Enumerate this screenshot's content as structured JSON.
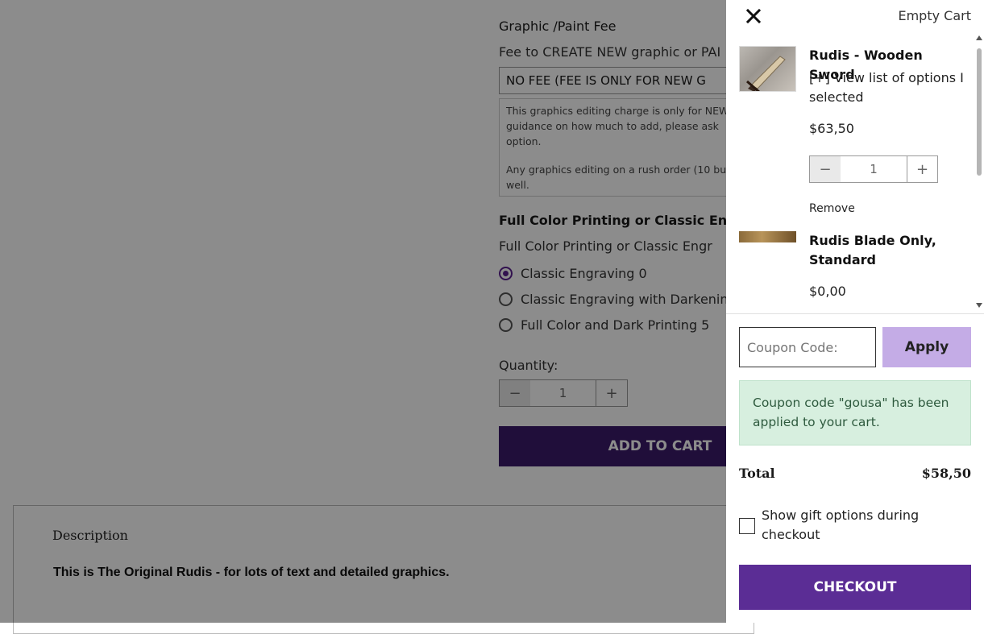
{
  "product": {
    "graphic_fee_title": "Graphic /Paint Fee",
    "graphic_fee_label": "Fee to CREATE NEW graphic or PAI",
    "graphic_fee_selected": "NO FEE (FEE IS ONLY FOR NEW G",
    "note_1_line_1": "This graphics editing charge is only for NEW",
    "note_1_line_2": "guidance on how much to add, please ask",
    "note_1_line_3": "option.",
    "note_2_line_1": "Any graphics editing on a rush order (10 bu",
    "note_2_line_2": "well.",
    "print_section_title": "Full Color Printing or Classic Engrav",
    "print_field_label": "Full Color Printing or Classic Engr",
    "print_options": [
      {
        "label": "Classic Engraving 0",
        "checked": true
      },
      {
        "label": "Classic Engraving with Darkenin",
        "checked": false
      },
      {
        "label": "Full Color and Dark Printing 5",
        "checked": false
      }
    ],
    "quantity_label": "Quantity:",
    "quantity_value": "1",
    "add_to_cart_label": "ADD TO CART",
    "description_tab": "Description",
    "description_text": "This is The Original Rudis - for lots of text and detailed graphics."
  },
  "cart": {
    "empty_cart_label": "Empty Cart",
    "items": [
      {
        "title": "Rudis - Wooden Sword",
        "options_link": "[+] View list of options I selected",
        "price": "$63,50",
        "quantity": "1",
        "remove_label": "Remove"
      },
      {
        "title": "Rudis Blade Only, Standard",
        "price": "$0,00"
      }
    ],
    "coupon_placeholder": "Coupon Code:",
    "apply_label": "Apply",
    "coupon_message": "Coupon code \"gousa\" has been applied to your cart.",
    "total_label": "Total",
    "total_value": "$58,50",
    "gift_option_label": "Show gift options during checkout",
    "gift_option_checked": false,
    "checkout_label": "CHECKOUT"
  },
  "colors": {
    "brand_purple": "#5b2d95",
    "apply_button": "#c4ace6",
    "success_bg": "#d7efdf"
  }
}
